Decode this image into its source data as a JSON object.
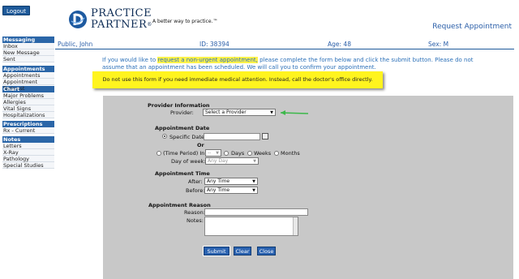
{
  "header": {
    "logout_label": "Logout",
    "logo_line1": "PRACTICE",
    "logo_line2": "PARTNER",
    "logo_registered": "®",
    "tagline": "A better way to practice.™",
    "page_title": "Request Appointment"
  },
  "sidebar": {
    "sections": [
      {
        "heading": "Messaging",
        "items": [
          "Inbox",
          "New Message",
          "Sent"
        ]
      },
      {
        "heading": "Appointments",
        "items": [
          "Appointments",
          "Appointment Request"
        ]
      },
      {
        "heading": "Chart",
        "items": [
          "Major Problems",
          "Allergies",
          "Vital Signs",
          "Hospitalizations"
        ]
      },
      {
        "heading": "Prescriptions",
        "items": [
          "Rx - Current"
        ]
      },
      {
        "heading": "Notes",
        "items": [
          "Letters",
          "X-Ray",
          "Pathology",
          "Special Studies"
        ]
      }
    ]
  },
  "patient": {
    "name": "Public, John",
    "id": "ID: 38394",
    "age": "Age: 48",
    "sex": "Sex: M"
  },
  "intro": {
    "part1": "If you would like to ",
    "highlight": "request a non-urgent appointment,",
    "part2": " please complete the form below and click the submit button.  Please do not",
    "line2": "assume that an appointment has been scheduled.  We will call you to confirm your appointment."
  },
  "warning": "Do not use this form if you need immediate medical attention.  Instead, call the doctor's office directly.",
  "form": {
    "provider_section": "Provider Information",
    "provider_label": "Provider:",
    "provider_value": "Select a Provider",
    "date_section": "Appointment Date",
    "specific_date_label": "Specific Date:",
    "or_label": "Or",
    "time_period_label": "(Time Period) In:",
    "time_period_value": "--",
    "days_label": "Days",
    "weeks_label": "Weeks",
    "months_label": "Months",
    "day_of_week_label": "Day of week:",
    "day_of_week_value": "Any Day",
    "time_section": "Appointment Time",
    "after_label": "After:",
    "after_value": "Any Time",
    "before_label": "Before:",
    "before_value": "Any Time",
    "reason_section": "Appointment Reason",
    "reason_label": "Reason:",
    "notes_label": "Notes:",
    "submit_label": "Submit",
    "clear_label": "Clear",
    "close_label": "Close"
  },
  "colors": {
    "accent": "#2b66a8",
    "highlight": "#fff24a",
    "warning_bg": "#fff41f",
    "panel_bg": "#c8c8c8",
    "arrow": "#3cb84a"
  },
  "icons": {
    "calendar": "calendar-icon",
    "pointer": "green-arrow-icon",
    "logo": "practice-partner-logo-icon"
  }
}
